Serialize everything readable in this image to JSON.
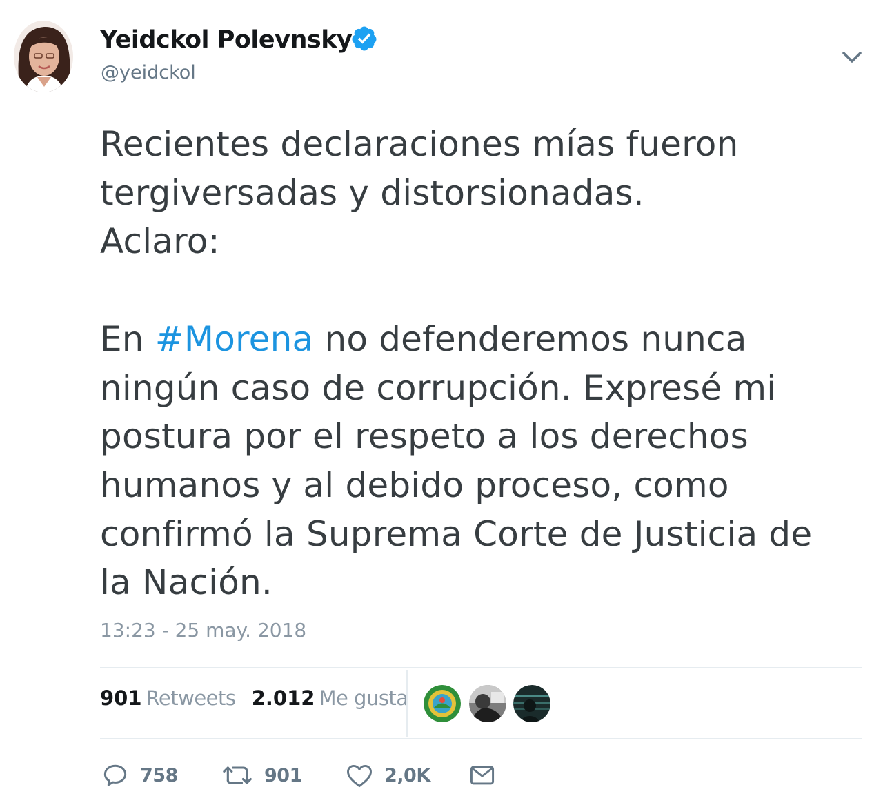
{
  "author": {
    "name": "Yeidckol Polevnsky",
    "handle": "@yeidckol",
    "verified": true
  },
  "tweet": {
    "lines_before": [
      "Recientes declaraciones mías fueron",
      "tergiversadas y distorsionadas.",
      "Aclaro:"
    ],
    "hashtag_line": {
      "prefix": "En ",
      "hashtag": "#Morena",
      "suffix": " no defenderemos nunca"
    },
    "lines_after": [
      "ningún caso de corrupción. Expresé mi",
      "postura por el respeto a los derechos",
      "humanos y al debido proceso, como",
      "confirmó la Suprema Corte de Justicia de",
      "la Nación."
    ],
    "timestamp": "13:23 - 25 may. 2018"
  },
  "stats": {
    "retweets_count": "901",
    "retweets_label": "Retweets",
    "likes_count": "2.012",
    "likes_label": "Me gusta"
  },
  "actions": {
    "reply_count": "758",
    "retweet_count": "901",
    "like_count": "2,0K"
  },
  "colors": {
    "link": "#1c94e0",
    "verified": "#1da1f2",
    "secondary_text": "#657786",
    "divider": "#e6ecf0"
  },
  "icons": {
    "verified": "verified-badge-icon",
    "caret": "chevron-down-icon",
    "reply": "reply-icon",
    "retweet": "retweet-icon",
    "like": "heart-icon",
    "dm": "envelope-icon"
  }
}
